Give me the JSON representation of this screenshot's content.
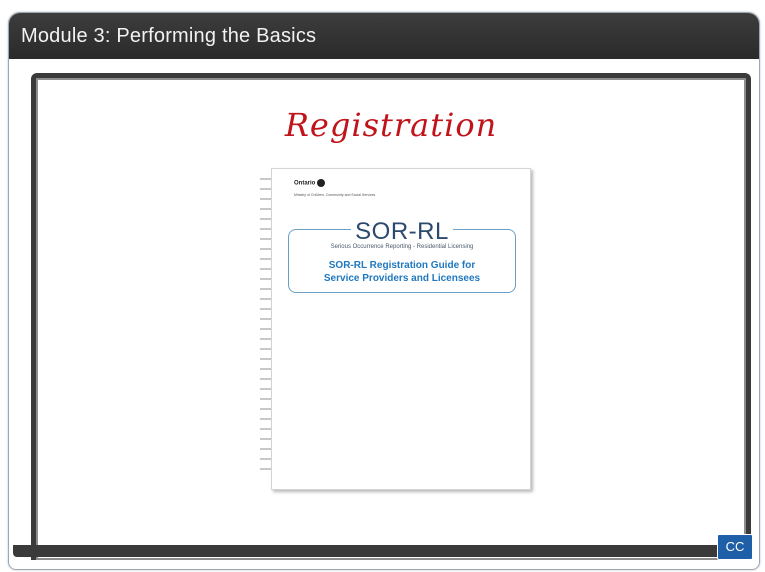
{
  "header": {
    "title": "Module 3:  Performing the Basics"
  },
  "slide": {
    "title": "Registration",
    "document": {
      "government": "Ontario",
      "ministry": "Ministry of Children, Community and Social Services",
      "logo": "SOR-RL",
      "subtitle": "Serious Occurrence Reporting - Residential Licensing",
      "guide_line1": "SOR-RL Registration Guide for",
      "guide_line2": "Service Providers and Licensees"
    }
  },
  "controls": {
    "cc_label": "CC"
  }
}
